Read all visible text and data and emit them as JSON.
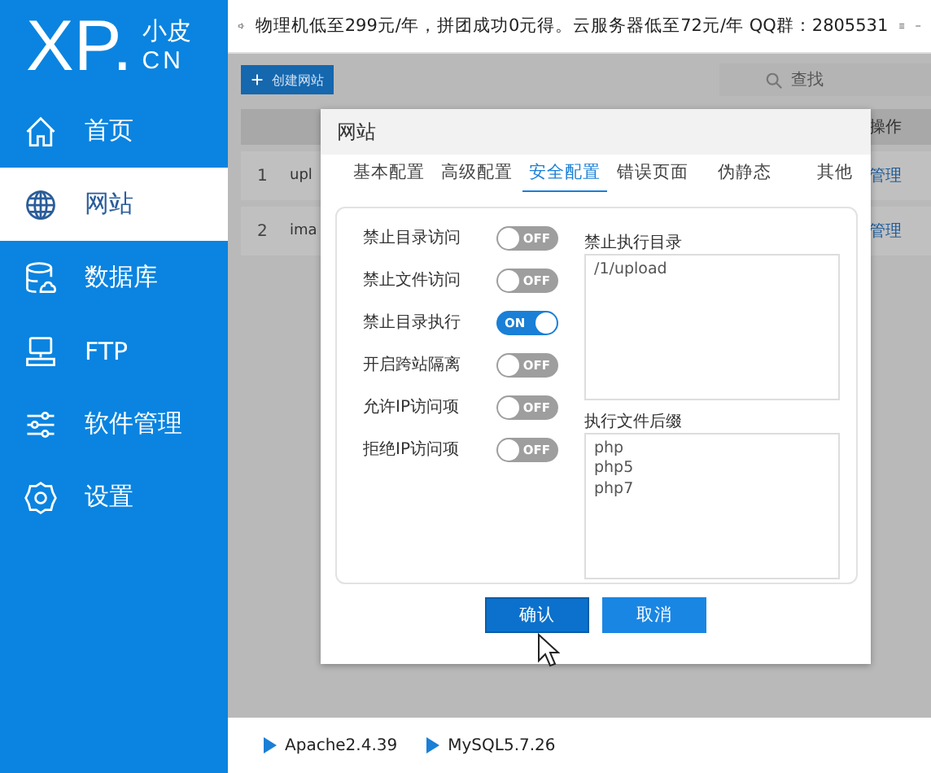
{
  "logo": {
    "mark": "XP.",
    "top": "小皮",
    "bottom": "CN"
  },
  "sidebar": {
    "items": [
      {
        "label": "首页",
        "selected": false
      },
      {
        "label": "网站",
        "selected": true
      },
      {
        "label": "数据库",
        "selected": false
      },
      {
        "label": "FTP",
        "selected": false
      },
      {
        "label": "软件管理",
        "selected": false
      },
      {
        "label": "设置",
        "selected": false
      }
    ]
  },
  "notice": {
    "text": "物理机低至299元/年，拼团成功0元得。云服务器低至72元/年  QQ群：2805531"
  },
  "toolbar": {
    "create_button": "创建网站",
    "search": {
      "placeholder": "查找"
    }
  },
  "table": {
    "action_header": "操作",
    "rows": [
      {
        "index": "1",
        "name": "upl",
        "action": "管理"
      },
      {
        "index": "2",
        "name": "ima",
        "action": "管理"
      }
    ]
  },
  "dialog": {
    "title": "网站",
    "tabs": [
      {
        "label": "基本配置",
        "selected": false
      },
      {
        "label": "高级配置",
        "selected": false
      },
      {
        "label": "安全配置",
        "selected": true
      },
      {
        "label": "错误页面",
        "selected": false
      },
      {
        "label": "伪静态",
        "selected": false
      },
      {
        "label": "其他",
        "selected": false
      }
    ],
    "toggles": [
      {
        "label": "禁止目录访问",
        "on": false,
        "state_text": "OFF"
      },
      {
        "label": "禁止文件访问",
        "on": false,
        "state_text": "OFF"
      },
      {
        "label": "禁止目录执行",
        "on": true,
        "state_text": "ON"
      },
      {
        "label": "开启跨站隔离",
        "on": false,
        "state_text": "OFF"
      },
      {
        "label": "允许IP访问项",
        "on": false,
        "state_text": "OFF"
      },
      {
        "label": "拒绝IP访问项",
        "on": false,
        "state_text": "OFF"
      }
    ],
    "fields": [
      {
        "label": "禁止执行目录",
        "lines": [
          "/1/upload"
        ]
      },
      {
        "label": "执行文件后缀",
        "lines": [
          "php",
          "php5",
          "php7"
        ]
      }
    ],
    "buttons": [
      {
        "label": "确认",
        "kind": "primary"
      },
      {
        "label": "取消",
        "kind": "secondary"
      }
    ]
  },
  "status_bar": [
    {
      "label": "Apache2.4.39"
    },
    {
      "label": "MySQL5.7.26"
    }
  ]
}
